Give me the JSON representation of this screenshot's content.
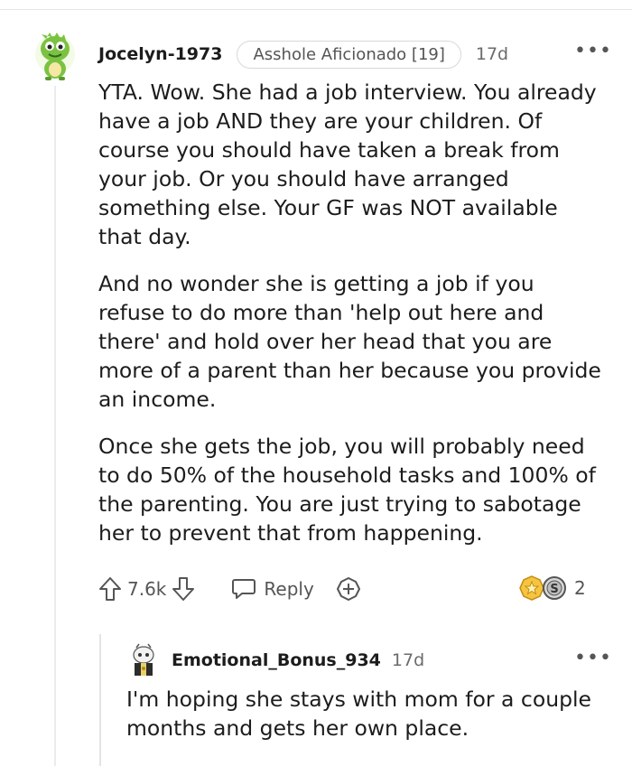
{
  "comment": {
    "avatar_icon": "snoo-dinosaur-avatar-icon",
    "username": "Jocelyn-1973",
    "flair": "Asshole Aficionado [19]",
    "time": "17d",
    "more_label": "•••",
    "paragraphs": [
      "YTA. Wow. She had a job interview. You already have a job AND they are your children. Of course you should have taken a break from your job. Or you should have arranged something else. Your GF was NOT available that day.",
      "And no wonder she is getting a job if you refuse to do more than 'help out here and there' and hold over her head that you are more of a parent than her because you provide an income.",
      "Once she gets the job, you will probably need to do 50% of the household tasks and 100% of the parenting. You are just trying to sabotage her to prevent that from happening."
    ],
    "actions": {
      "upvote_icon": "upvote-arrow-icon",
      "vote_count": "7.6k",
      "downvote_icon": "downvote-arrow-icon",
      "reply_icon": "speech-bubble-icon",
      "reply_label": "Reply",
      "award_icon": "add-award-icon"
    },
    "awards": {
      "icons": [
        "gold-star-award-icon",
        "silver-coin-award-icon"
      ],
      "count": "2"
    }
  },
  "reply": {
    "avatar_icon": "snoo-avatar-icon",
    "username": "Emotional_Bonus_934",
    "time": "17d",
    "more_label": "•••",
    "body": "I'm hoping she stays with mom for a couple months and gets her own place."
  }
}
